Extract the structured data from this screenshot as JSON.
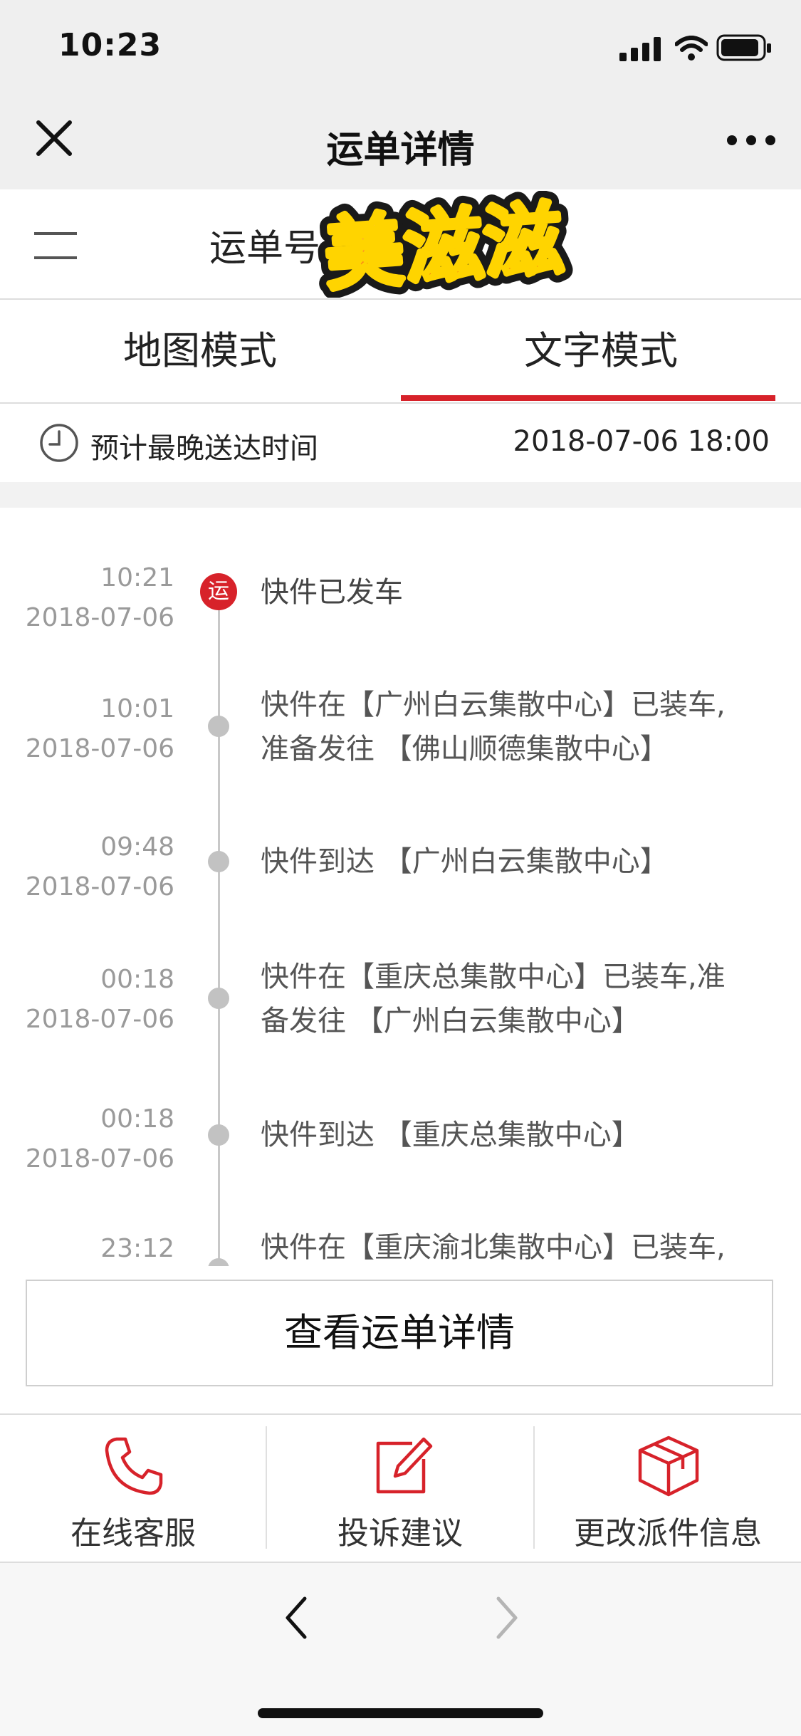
{
  "status_bar": {
    "time": "10:23"
  },
  "nav": {
    "title": "运单详情"
  },
  "waybill": {
    "label": "运单号",
    "logo_text": "美滋滋"
  },
  "tabs": [
    {
      "label": "地图模式",
      "active": false
    },
    {
      "label": "文字模式",
      "active": true
    }
  ],
  "eta": {
    "label": "预计最晚送达时间",
    "value": "2018-07-06 18:00"
  },
  "events": [
    {
      "time": "10:21",
      "date": "2018-07-06",
      "lines": [
        "快件已发车"
      ],
      "badge": "运"
    },
    {
      "time": "10:01",
      "date": "2018-07-06",
      "lines": [
        "快件在【广州白云集散中心】已装车,",
        "准备发往 【佛山顺德集散中心】"
      ]
    },
    {
      "time": "09:48",
      "date": "2018-07-06",
      "lines": [
        "快件到达 【广州白云集散中心】"
      ]
    },
    {
      "time": "00:18",
      "date": "2018-07-06",
      "lines": [
        "快件在【重庆总集散中心】已装车,准",
        "备发往 【广州白云集散中心】"
      ]
    },
    {
      "time": "00:18",
      "date": "2018-07-06",
      "lines": [
        "快件到达 【重庆总集散中心】"
      ]
    },
    {
      "time": "23:12",
      "date": "",
      "lines": [
        "快件在【重庆渝北集散中心】已装车,"
      ]
    }
  ],
  "detail_button": "查看运单详情",
  "actions": [
    {
      "label": "在线客服",
      "icon": "phone-icon"
    },
    {
      "label": "投诉建议",
      "icon": "edit-icon"
    },
    {
      "label": "更改派件信息",
      "icon": "box-icon"
    }
  ],
  "colors": {
    "accent": "#d7222a",
    "background": "#efefef"
  }
}
